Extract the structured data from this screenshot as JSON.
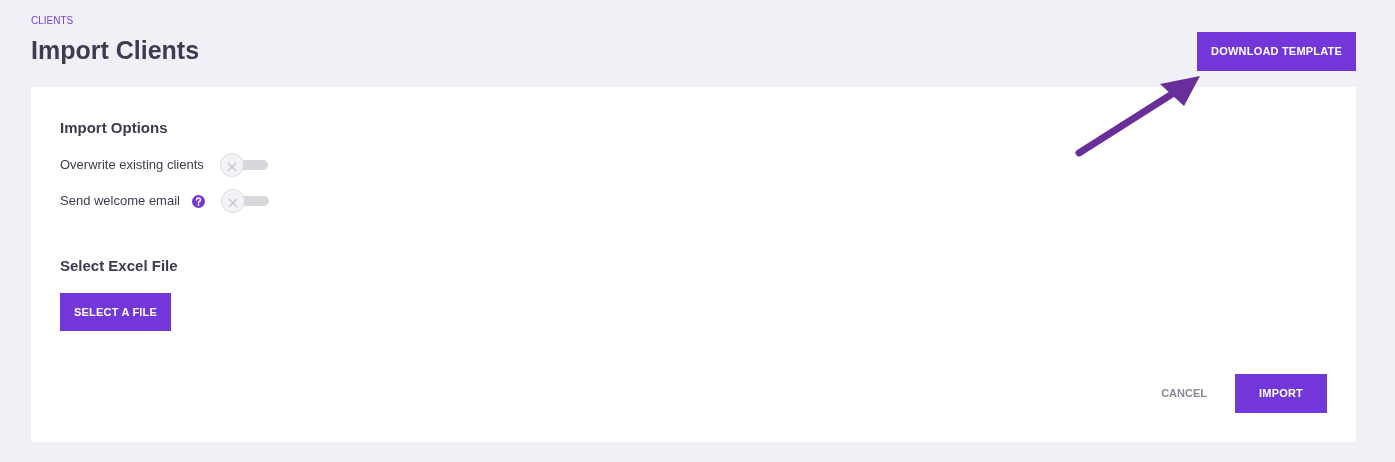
{
  "breadcrumb": "CLIENTS",
  "title": "Import Clients",
  "download_button": "DOWNLOAD TEMPLATE",
  "options_heading": "Import Options",
  "options": [
    {
      "label": "Overwrite existing clients",
      "on": false,
      "help": false
    },
    {
      "label": "Send welcome email",
      "on": false,
      "help": true
    }
  ],
  "file_heading": "Select Excel File",
  "select_button": "SELECT A FILE",
  "cancel_button": "CANCEL",
  "import_button": "IMPORT"
}
